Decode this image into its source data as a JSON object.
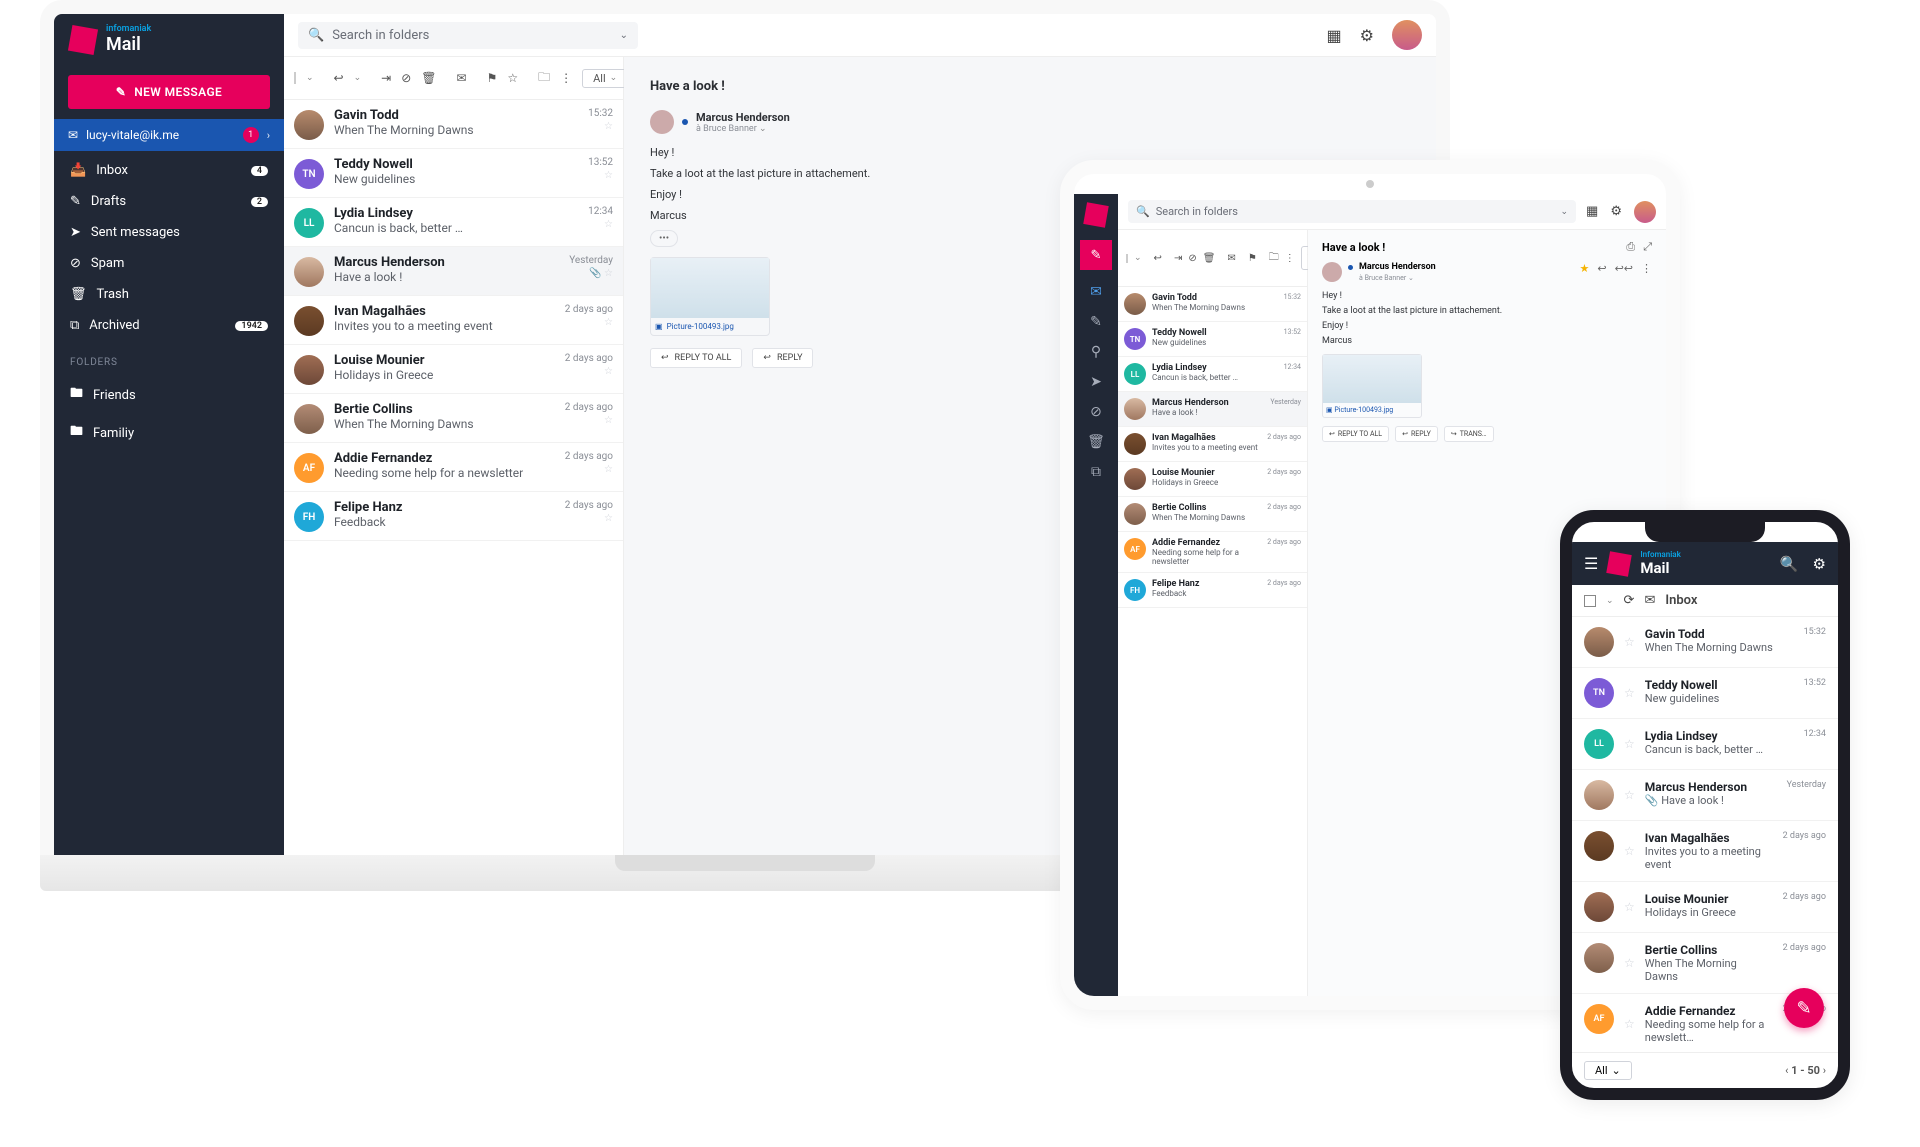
{
  "brand": {
    "parent": "infomaniak",
    "app": "Mail",
    "parent_cap": "Infomaniak"
  },
  "search_placeholder": "Search in folders",
  "new_message": "NEW MESSAGE",
  "account": {
    "email": "lucy-vitale@ik.me",
    "badge": "1"
  },
  "nav": [
    {
      "icon": "inbox",
      "label": "Inbox",
      "count": "4"
    },
    {
      "icon": "drafts",
      "label": "Drafts",
      "count": "2"
    },
    {
      "icon": "sent",
      "label": "Sent messages"
    },
    {
      "icon": "spam",
      "label": "Spam"
    },
    {
      "icon": "trash",
      "label": "Trash"
    },
    {
      "icon": "archive",
      "label": "Archived",
      "count": "1942"
    }
  ],
  "folders_label": "FOLDERS",
  "folders": [
    {
      "label": "Friends"
    },
    {
      "label": "Familiy"
    }
  ],
  "filter": "All",
  "pagination": "1 - 50",
  "messages": [
    {
      "from": "Gavin Todd",
      "subject": "When The Morning Dawns",
      "time": "15:32",
      "av": "av-gavin",
      "init": ""
    },
    {
      "from": "Teddy Nowell",
      "subject": "New guidelines",
      "time": "13:52",
      "av": "av-tn",
      "init": "TN"
    },
    {
      "from": "Lydia Lindsey",
      "subject": "Cancun is back, better …",
      "time": "12:34",
      "av": "av-ll",
      "init": "LL"
    },
    {
      "from": "Marcus Henderson",
      "subject": "Have a look !",
      "time": "Yesterday",
      "av": "av-mh",
      "init": "",
      "selected": true,
      "attach": true
    },
    {
      "from": "Ivan Magalhães",
      "subject": "Invites you to a meeting event",
      "time": "2 days ago",
      "av": "av-ivan",
      "init": ""
    },
    {
      "from": "Louise Mounier",
      "subject": "Holidays in Greece",
      "time": "2 days ago",
      "av": "av-lm",
      "init": ""
    },
    {
      "from": "Bertie Collins",
      "subject": "When The Morning Dawns",
      "time": "2 days ago",
      "av": "av-bc",
      "init": ""
    },
    {
      "from": "Addie Fernandez",
      "subject": "Needing some help for a newsletter",
      "time": "2 days ago",
      "av": "av-af",
      "init": "AF"
    },
    {
      "from": "Felipe Hanz",
      "subject": "Feedback",
      "time": "2 days ago",
      "av": "av-fh",
      "init": "FH"
    }
  ],
  "reader": {
    "subject": "Have a look !",
    "from": "Marcus Henderson",
    "to_prefix": "à",
    "to": "Bruce Banner",
    "body": [
      "Hey !",
      "Take a loot at the last picture in attachement.",
      "Enjoy !",
      "Marcus"
    ],
    "more": "•••",
    "attachment": "Picture-100493.jpg",
    "reply_all": "REPLY TO ALL",
    "reply": "REPLY",
    "transfer": "TRANS…"
  },
  "tablet": {
    "messages": [
      {
        "from": "Gavin Todd",
        "subject": "When The Morning Dawns",
        "time": "15:32",
        "av": "av-gavin"
      },
      {
        "from": "Teddy Nowell",
        "subject": "New guidelines",
        "time": "13:52",
        "av": "av-tn",
        "init": "TN"
      },
      {
        "from": "Lydia Lindsey",
        "subject": "Cancun is back, better …",
        "time": "12:34",
        "av": "av-ll",
        "init": "LL"
      },
      {
        "from": "Marcus Henderson",
        "subject": "Have a look !",
        "time": "Yesterday",
        "av": "av-mh",
        "selected": true
      },
      {
        "from": "Ivan Magalhães",
        "subject": "Invites you to a meeting event",
        "time": "2 days ago",
        "av": "av-ivan"
      },
      {
        "from": "Louise Mounier",
        "subject": "Holidays in Greece",
        "time": "2 days ago",
        "av": "av-lm"
      },
      {
        "from": "Bertie Collins",
        "subject": "When The Morning Dawns",
        "time": "2 days ago",
        "av": "av-bc"
      },
      {
        "from": "Addie Fernandez",
        "subject": "Needing some help for a newsletter",
        "time": "2 days ago",
        "av": "av-af",
        "init": "AF"
      },
      {
        "from": "Felipe Hanz",
        "subject": "Feedback",
        "time": "2 days ago",
        "av": "av-fh",
        "init": "FH"
      }
    ]
  },
  "phone": {
    "inbox_label": "Inbox",
    "messages": [
      {
        "from": "Gavin Todd",
        "subject": "When The Morning Dawns",
        "time": "15:32",
        "av": "av-gavin"
      },
      {
        "from": "Teddy Nowell",
        "subject": "New guidelines",
        "time": "13:52",
        "av": "av-tn",
        "init": "TN"
      },
      {
        "from": "Lydia Lindsey",
        "subject": "Cancun is back, better …",
        "time": "12:34",
        "av": "av-ll",
        "init": "LL"
      },
      {
        "from": "Marcus Henderson",
        "subject": "Have a look !",
        "time": "Yesterday",
        "av": "av-mh",
        "attach": true
      },
      {
        "from": "Ivan Magalhães",
        "subject": "Invites you to a meeting event",
        "time": "2 days ago",
        "av": "av-ivan"
      },
      {
        "from": "Louise Mounier",
        "subject": "Holidays in Greece",
        "time": "2 days ago",
        "av": "av-lm"
      },
      {
        "from": "Bertie Collins",
        "subject": "When The Morning Dawns",
        "time": "2 days ago",
        "av": "av-bc"
      },
      {
        "from": "Addie Fernandez",
        "subject": "Needing some help for a newslett…",
        "time": "2 days ago",
        "av": "av-af",
        "init": "AF"
      }
    ]
  }
}
